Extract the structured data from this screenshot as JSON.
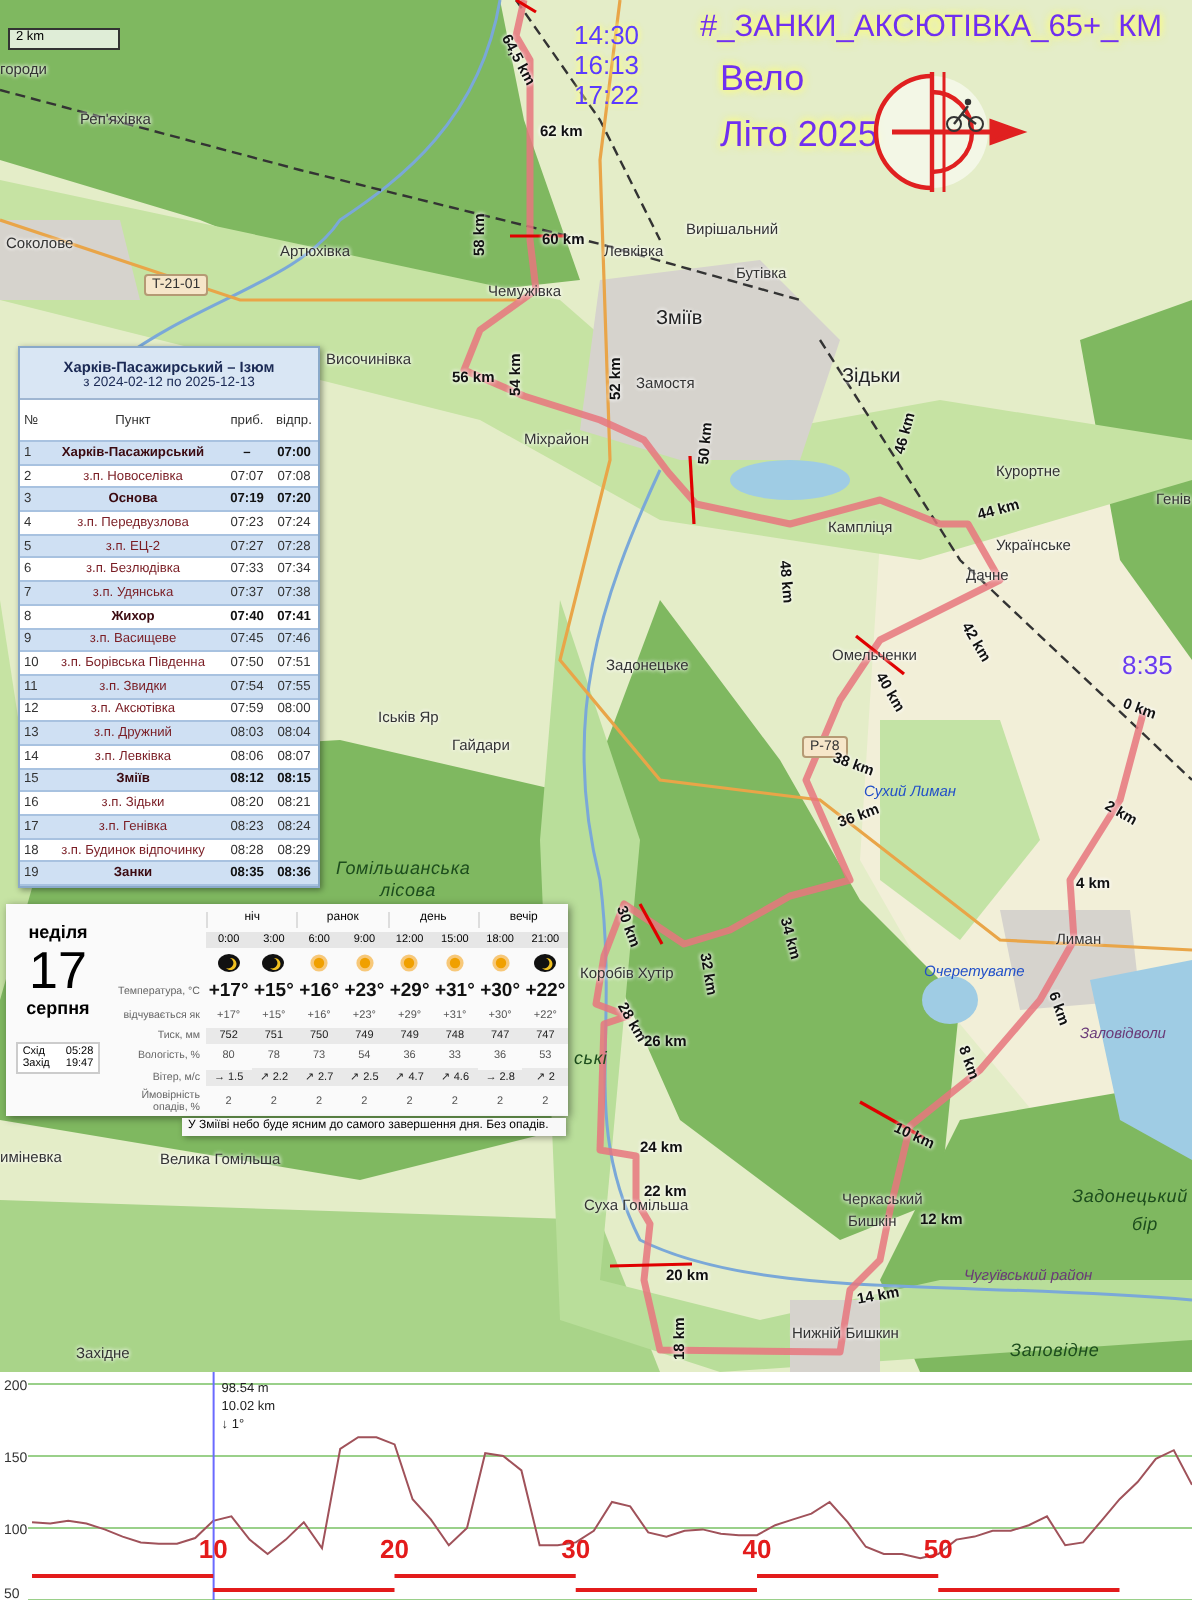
{
  "map": {
    "scale": "2 km",
    "places": [
      {
        "name": "городи",
        "kind": "settlement"
      },
      {
        "name": "Реп'яхівка",
        "kind": "settlement"
      },
      {
        "name": "Соколове",
        "kind": "settlement"
      },
      {
        "name": "Артюхівка",
        "kind": "settlement"
      },
      {
        "name": "Чемужівка",
        "kind": "settlement"
      },
      {
        "name": "Левківка",
        "kind": "settlement"
      },
      {
        "name": "Вирішальний",
        "kind": "settlement"
      },
      {
        "name": "Бутівка",
        "kind": "settlement"
      },
      {
        "name": "Зміїв",
        "kind": "town"
      },
      {
        "name": "Височинівка",
        "kind": "settlement"
      },
      {
        "name": "Замостя",
        "kind": "settlement"
      },
      {
        "name": "Зідьки",
        "kind": "town"
      },
      {
        "name": "Міхрайон",
        "kind": "settlement"
      },
      {
        "name": "Курортне",
        "kind": "settlement"
      },
      {
        "name": "Кампліця",
        "kind": "settlement"
      },
      {
        "name": "Українське",
        "kind": "settlement"
      },
      {
        "name": "Дачне",
        "kind": "settlement"
      },
      {
        "name": "Омельченки",
        "kind": "settlement"
      },
      {
        "name": "Задонецьке",
        "kind": "settlement"
      },
      {
        "name": "Генів",
        "kind": "settlement"
      },
      {
        "name": "Іськів Яр",
        "kind": "settlement"
      },
      {
        "name": "Гайдари",
        "kind": "settlement"
      },
      {
        "name": "Сухий Лиман",
        "kind": "water"
      },
      {
        "name": "Гомільшанська",
        "kind": "area"
      },
      {
        "name": "лісова",
        "kind": "area"
      },
      {
        "name": "Коробів Хутір",
        "kind": "settlement"
      },
      {
        "name": "Лиман",
        "kind": "settlement"
      },
      {
        "name": "Очеретувате",
        "kind": "water"
      },
      {
        "name": "Заловідволи",
        "kind": "district"
      },
      {
        "name": "ські",
        "kind": "area"
      },
      {
        "name": "иміневка",
        "kind": "settlement"
      },
      {
        "name": "Велика Гомільша",
        "kind": "settlement"
      },
      {
        "name": "Суха Гомільша",
        "kind": "settlement"
      },
      {
        "name": "Черкаський",
        "kind": "settlement"
      },
      {
        "name": "Бишкін",
        "kind": "settlement"
      },
      {
        "name": "Задонецький",
        "kind": "area"
      },
      {
        "name": "бір",
        "kind": "area"
      },
      {
        "name": "Чугуївський район",
        "kind": "district"
      },
      {
        "name": "Нижній Бишкин",
        "kind": "settlement"
      },
      {
        "name": "Заповідне",
        "kind": "area"
      },
      {
        "name": "Західне",
        "kind": "settlement"
      }
    ],
    "road_shields": [
      "T-21-01",
      "Р-78"
    ],
    "distance_marks": [
      "64,5 km",
      "62 km",
      "60 km",
      "58 km",
      "56 km",
      "54 km",
      "52 km",
      "50 km",
      "48 km",
      "46 km",
      "44 km",
      "42 km",
      "40 km",
      "38 km",
      "36 km",
      "34 km",
      "32 km",
      "30 km",
      "28 km",
      "26 km",
      "24 km",
      "22 km",
      "20 km",
      "18 km",
      "14 km",
      "12 km",
      "10 km",
      "8 km",
      "6 km",
      "4 km",
      "2 km",
      "0 km"
    ]
  },
  "route_info": {
    "times": [
      "14:30",
      "16:13",
      "17:22"
    ],
    "title": "#_ЗАНКИ_АКСЮТІВКА_65+_КМ",
    "lines": [
      "Вело",
      "Літо 2025"
    ],
    "start_time": "8:35"
  },
  "timetable": {
    "title": "Харків-Пасажирський – Ізюм",
    "subtitle": "з 2024-02-12 по 2025-12-13",
    "columns": [
      "№",
      "Пункт",
      "приб.",
      "відпр."
    ],
    "rows": [
      {
        "n": "1",
        "stop": "Харків-Пасажирський",
        "arrive": "–",
        "depart": "07:00",
        "major": true
      },
      {
        "n": "2",
        "stop": "з.п. Новоселівка",
        "arrive": "07:07",
        "depart": "07:08",
        "major": false
      },
      {
        "n": "3",
        "stop": "Основа",
        "arrive": "07:19",
        "depart": "07:20",
        "major": true
      },
      {
        "n": "4",
        "stop": "з.п. Передвузлова",
        "arrive": "07:23",
        "depart": "07:24",
        "major": false
      },
      {
        "n": "5",
        "stop": "з.п. ЕЦ-2",
        "arrive": "07:27",
        "depart": "07:28",
        "major": false
      },
      {
        "n": "6",
        "stop": "з.п. Безлюдівка",
        "arrive": "07:33",
        "depart": "07:34",
        "major": false
      },
      {
        "n": "7",
        "stop": "з.п. Удянська",
        "arrive": "07:37",
        "depart": "07:38",
        "major": false
      },
      {
        "n": "8",
        "stop": "Жихор",
        "arrive": "07:40",
        "depart": "07:41",
        "major": true
      },
      {
        "n": "9",
        "stop": "з.п. Васищеве",
        "arrive": "07:45",
        "depart": "07:46",
        "major": false
      },
      {
        "n": "10",
        "stop": "з.п. Борівська Південна",
        "arrive": "07:50",
        "depart": "07:51",
        "major": false
      },
      {
        "n": "11",
        "stop": "з.п. Звидки",
        "arrive": "07:54",
        "depart": "07:55",
        "major": false
      },
      {
        "n": "12",
        "stop": "з.п. Аксютівка",
        "arrive": "07:59",
        "depart": "08:00",
        "major": false
      },
      {
        "n": "13",
        "stop": "з.п. Дружний",
        "arrive": "08:03",
        "depart": "08:04",
        "major": false
      },
      {
        "n": "14",
        "stop": "з.п. Левківка",
        "arrive": "08:06",
        "depart": "08:07",
        "major": false
      },
      {
        "n": "15",
        "stop": "Зміїв",
        "arrive": "08:12",
        "depart": "08:15",
        "major": true
      },
      {
        "n": "16",
        "stop": "з.п. Зідьки",
        "arrive": "08:20",
        "depart": "08:21",
        "major": false
      },
      {
        "n": "17",
        "stop": "з.п. Генівка",
        "arrive": "08:23",
        "depart": "08:24",
        "major": false
      },
      {
        "n": "18",
        "stop": "з.п. Будинок відпочинку",
        "arrive": "08:28",
        "depart": "08:29",
        "major": false
      },
      {
        "n": "19",
        "stop": "Занки",
        "arrive": "08:35",
        "depart": "08:36",
        "major": true
      }
    ]
  },
  "weather": {
    "weekday": "неділя",
    "day": "17",
    "month": "серпня",
    "periods": [
      "ніч",
      "ранок",
      "день",
      "вечір"
    ],
    "times": [
      "0:00",
      "3:00",
      "6:00",
      "9:00",
      "12:00",
      "15:00",
      "18:00",
      "21:00"
    ],
    "sky": [
      {
        "kind": "night"
      },
      {
        "kind": "night"
      },
      {
        "kind": "sun"
      },
      {
        "kind": "sun"
      },
      {
        "kind": "sun"
      },
      {
        "kind": "sun"
      },
      {
        "kind": "sun"
      },
      {
        "kind": "night"
      }
    ],
    "rows": [
      {
        "kind": "temp",
        "label": "Температура, °C",
        "values": [
          "+17°",
          "+15°",
          "+16°",
          "+23°",
          "+29°",
          "+31°",
          "+30°",
          "+22°"
        ]
      },
      {
        "kind": "plain",
        "label": "відчувається як",
        "values": [
          "+17°",
          "+15°",
          "+16°",
          "+23°",
          "+29°",
          "+31°",
          "+30°",
          "+22°"
        ]
      },
      {
        "kind": "band",
        "label": "Тиск, мм",
        "values": [
          "752",
          "751",
          "750",
          "749",
          "749",
          "748",
          "747",
          "747"
        ]
      },
      {
        "kind": "plain",
        "label": "Вологість, %",
        "values": [
          "80",
          "78",
          "73",
          "54",
          "36",
          "33",
          "36",
          "53"
        ]
      },
      {
        "kind": "band",
        "label": "Вітер, м/с",
        "values": [
          "→ 1.5",
          "↗ 2.2",
          "↗ 2.7",
          "↗ 2.5",
          "↗ 4.7",
          "↗ 4.6",
          "→ 2.8",
          "↗ 2"
        ]
      },
      {
        "kind": "plain",
        "label": "Ймовірність опадів, %",
        "values": [
          "2",
          "2",
          "2",
          "2",
          "2",
          "2",
          "2",
          "2"
        ]
      }
    ],
    "sunrise_label": "Схід",
    "sunrise": "05:28",
    "sunset_label": "Захід",
    "sunset": "19:47",
    "note": "У Зміїві небо буде ясним до самого завершення дня. Без опадів."
  },
  "profile": {
    "cursor": [
      "98.54 m",
      "10.02 km",
      "↓ 1°"
    ],
    "chart_data": {
      "type": "line",
      "xlim": [
        0,
        64
      ],
      "ylim": [
        50,
        200
      ],
      "yticks": [
        50,
        100,
        150,
        200
      ],
      "xticks": [
        10,
        20,
        30,
        40,
        50
      ],
      "ref_lines": [
        {
          "axis": "x",
          "value": 10.02
        }
      ],
      "x": [
        0,
        1,
        2,
        3,
        4,
        5,
        6,
        7,
        8,
        9,
        10,
        11,
        12,
        13,
        14,
        15,
        16,
        17,
        18,
        19,
        20,
        21,
        22,
        23,
        24,
        25,
        26,
        27,
        28,
        29,
        30,
        31,
        32,
        33,
        34,
        35,
        36,
        37,
        38,
        39,
        40,
        41,
        42,
        43,
        44,
        45,
        46,
        47,
        48,
        49,
        50,
        51,
        52,
        53,
        54,
        55,
        56,
        57,
        58,
        59,
        60,
        61,
        62,
        63,
        64
      ],
      "series": [
        {
          "color": "#a0525a",
          "values": [
            104,
            103,
            105,
            103,
            99,
            94,
            90,
            89,
            89,
            93,
            105,
            108,
            92,
            82,
            92,
            104,
            86,
            155,
            163,
            163,
            158,
            120,
            106,
            88,
            100,
            152,
            150,
            140,
            88,
            88,
            90,
            98,
            118,
            115,
            97,
            94,
            98,
            99,
            96,
            95,
            95,
            102,
            106,
            110,
            118,
            104,
            87,
            82,
            82,
            79,
            82,
            92,
            94,
            98,
            98,
            102,
            108,
            88,
            90,
            105,
            120,
            132,
            148,
            154,
            130
          ]
        }
      ]
    }
  }
}
